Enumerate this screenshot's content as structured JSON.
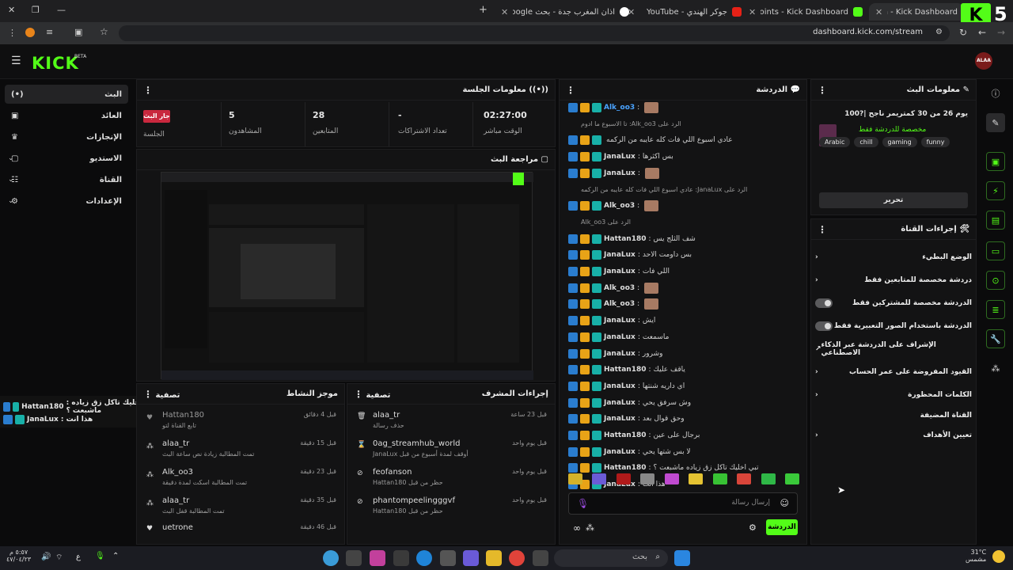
{
  "browser": {
    "tabs": [
      {
        "title": "Stream - Kick Dashboard",
        "active": true
      },
      {
        "title": "Channel Points - Kick Dashboard",
        "active": false
      },
      {
        "title": "جوكر الهندي - YouTube",
        "active": false
      },
      {
        "title": "اذان المغرب جدة - بحث Google",
        "active": false
      }
    ],
    "new_tab": "+",
    "url": "dashboard.kick.com/stream",
    "overlay_number": "5"
  },
  "app": {
    "logo": "KICK",
    "logo_sup": "BETA",
    "avatar": "ALAA",
    "accent": "#53fc18"
  },
  "leftnav": {
    "items": [
      {
        "label": "البث",
        "icon": "live-icon"
      },
      {
        "label": "العائد",
        "icon": "wallet-icon"
      },
      {
        "label": "الإنجازات",
        "icon": "trophy-icon"
      },
      {
        "label": "الاستديو",
        "icon": "studio-icon"
      },
      {
        "label": "القناة",
        "icon": "channel-icon"
      },
      {
        "label": "الإعدادات",
        "icon": "gear-icon"
      }
    ]
  },
  "session": {
    "title": "معلومات الجلسة",
    "live_badge": "جار البث",
    "session_label": "الجلسة",
    "stats": [
      {
        "value": "5",
        "label": "المشاهدون"
      },
      {
        "value": "28",
        "label": "المتابعين"
      },
      {
        "value": "-",
        "label": "تعداد الاشتراكات"
      },
      {
        "value": "02:27:00",
        "label": "الوقت مباشر"
      }
    ]
  },
  "preview": {
    "title": "مراجعة البث"
  },
  "activity": {
    "title": "موجز النشاط",
    "filter": "تصفية",
    "items": [
      {
        "user": "Hattan180",
        "desc": "تابع القناة لتو",
        "time": "قبل 4 دقائق"
      },
      {
        "user": "alaa_tr",
        "desc": "تمت المطالبة زيادة نص ساعة البث",
        "time": "قبل 15 دقيقة"
      },
      {
        "user": "Alk_oo3",
        "desc": "تمت المطالبة اسكت لمدة دقيقة",
        "time": "قبل 23 دقيقة"
      },
      {
        "user": "alaa_tr",
        "desc": "تمت المطالبة قفل البث",
        "time": "قبل 35 دقيقة"
      },
      {
        "user": "uetrone",
        "desc": "",
        "time": "قبل 46 دقيقة"
      }
    ]
  },
  "modlog": {
    "title": "إجراءات المشرف",
    "filter": "تصفية",
    "items": [
      {
        "user": "alaa_tr",
        "desc": "حذف رسالة",
        "time": "قبل 23 ساعة"
      },
      {
        "user": "0ag_streamhub_world",
        "desc": "أوقف لمدة أسبوع من قبل JanaLux",
        "time": "قبل يوم واحد"
      },
      {
        "user": "feofanson",
        "desc": "حظر من قبل Hattan180",
        "time": "قبل يوم واحد"
      },
      {
        "user": "phantompeelingggvf",
        "desc": "حظر من قبل Hattan180",
        "time": "قبل يوم واحد"
      }
    ]
  },
  "chat": {
    "title": "الدردشة",
    "placeholder": "إرسال رسالة",
    "send_label": "الدردشة",
    "messages": [
      {
        "user": "Alk_oo3",
        "text": "",
        "user_color": "#4aa3ff",
        "reply": ""
      },
      {
        "user": "",
        "text": "",
        "reply": "الرد على Alk_oo3: تا الاسبوع ما ادوم"
      },
      {
        "user": "",
        "text": "عادي اسبوع اللي فات كله عايبه من الركمه",
        "reply": ""
      },
      {
        "user": "JanaLux",
        "text": "بس اكثرها",
        "reply": ""
      },
      {
        "user": "JanaLux",
        "text": "",
        "reply": ""
      },
      {
        "user": "",
        "text": "",
        "reply": "الرد على JanaLux: عادي اسبوع اللي فات كله عايبه من الركمه"
      },
      {
        "user": "Alk_oo3",
        "text": "",
        "reply": ""
      },
      {
        "user": "",
        "text": "",
        "reply": "الرد على Alk_oo3"
      },
      {
        "user": "Hattan180",
        "text": "شف الثلج يس",
        "reply": ""
      },
      {
        "user": "JanaLux",
        "text": "بس داومت الاحد",
        "reply": ""
      },
      {
        "user": "JanaLux",
        "text": "اللي فات",
        "reply": ""
      },
      {
        "user": "Alk_oo3",
        "text": "",
        "reply": ""
      },
      {
        "user": "Alk_oo3",
        "text": "",
        "reply": ""
      },
      {
        "user": "JanaLux",
        "text": "ايش",
        "reply": ""
      },
      {
        "user": "JanaLux",
        "text": "ماسمعت",
        "reply": ""
      },
      {
        "user": "JanaLux",
        "text": "وشرور",
        "reply": ""
      },
      {
        "user": "Hattan180",
        "text": "ياقف عليك",
        "reply": ""
      },
      {
        "user": "JanaLux",
        "text": "اي داريه شنتها",
        "reply": ""
      },
      {
        "user": "JanaLux",
        "text": "وش سرفق يحي",
        "reply": ""
      },
      {
        "user": "JanaLux",
        "text": "وحق قوال بعد",
        "reply": ""
      },
      {
        "user": "Hattan180",
        "text": "برجال على عين",
        "reply": ""
      },
      {
        "user": "JanaLux",
        "text": "لا بس شتها يحي",
        "reply": ""
      },
      {
        "user": "Hattan180",
        "text": "تبي اخليك تاكل زق زياده ماشبعت ؟",
        "reply": ""
      },
      {
        "user": "JanaLux",
        "text": "هذا انت",
        "reply": ""
      }
    ]
  },
  "overlay_chat": [
    {
      "user": "Hattan180",
      "text": ": تبي اخليك تاكل زق زياده ماشبعت ؟"
    },
    {
      "user": "JanaLux",
      "text": ": هذا انت"
    }
  ],
  "streaminfo": {
    "title": "معلومات البث",
    "stream_title": "يوم 26 من 30 كمتريمر ناجح |?100",
    "category": "مخصصة للدردشة فقط",
    "tags": [
      "Arabic",
      "chill",
      "gaming",
      "funny"
    ],
    "edit": "تحرير"
  },
  "channel_actions": {
    "title": "إجراءات القناة",
    "items": [
      {
        "label": "الوضع البطيء",
        "control": "chevron"
      },
      {
        "label": "دردشة مخصصة للمتابعين فقط",
        "control": "chevron"
      },
      {
        "label": "الدردشة مخصصة للمشتركين فقط",
        "control": "toggle"
      },
      {
        "label": "الدردشة باستخدام الصور التعبيرية فقط",
        "control": "toggle"
      },
      {
        "label": "الإشراف على الدردشة عبر الذكاء الاصطناعي",
        "control": "external"
      },
      {
        "label": "القيود المفروضة على عمر الحساب",
        "control": "chevron"
      },
      {
        "label": "الكلمات المحظورة",
        "control": "chevron"
      },
      {
        "label": "القناة المضيفة",
        "control": "none"
      },
      {
        "label": "تعيين الأهداف",
        "control": "chevron"
      }
    ]
  },
  "sidebar_right": [
    "info-icon",
    "edit-icon",
    "preview-icon",
    "bolt-icon",
    "notes-icon",
    "chat-icon",
    "broadcast-icon",
    "stack-icon",
    "wrench-icon",
    "apps-icon"
  ],
  "taskbar": {
    "time": "٥:٥٧ م",
    "date": "٤٧/٠٤/٢٣",
    "lang": "ع",
    "search": "بحث",
    "weather_temp": "31°C",
    "weather_desc": "مشمس"
  }
}
